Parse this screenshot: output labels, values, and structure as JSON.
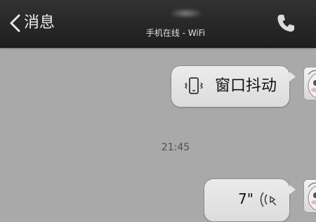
{
  "header": {
    "back_label": "消息",
    "status": "手机在线 - WiFi"
  },
  "messages": [
    {
      "type": "shake",
      "label": "窗口抖动"
    },
    {
      "type": "voice",
      "duration": "7\""
    }
  ],
  "timestamp": "21:45",
  "icons": [
    "chevron-left-icon",
    "phone-icon",
    "phone-shake-icon",
    "voice-wave-icon",
    "avatar"
  ]
}
